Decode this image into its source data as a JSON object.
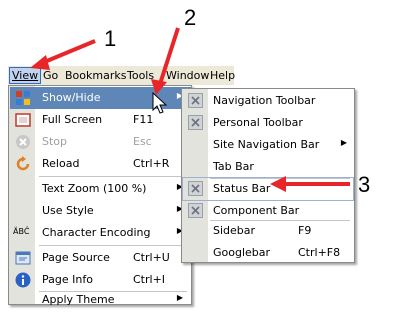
{
  "callouts": {
    "one": "1",
    "two": "2",
    "three": "3"
  },
  "menubar": {
    "items": [
      {
        "label": "View",
        "key": "V"
      },
      {
        "label": "Go",
        "key": "G"
      },
      {
        "label": "Bookmarks",
        "key": "B"
      },
      {
        "label": "Tools",
        "key": "T"
      },
      {
        "label": "Window",
        "key": "W"
      },
      {
        "label": "Help",
        "key": "H"
      }
    ]
  },
  "view_menu": {
    "items": [
      {
        "label": "Show/Hide",
        "shortcut": "",
        "submenu": true,
        "icon": "show-hide-icon",
        "state": "highlighted"
      },
      {
        "label": "Full Screen",
        "shortcut": "F11",
        "icon": "full-screen-icon"
      },
      {
        "label": "Stop",
        "shortcut": "Esc",
        "icon": "stop-icon",
        "state": "disabled"
      },
      {
        "label": "Reload",
        "shortcut": "Ctrl+R",
        "icon": "reload-icon"
      },
      {
        "label": "Text Zoom (100 %)",
        "shortcut": "",
        "submenu": true
      },
      {
        "label": "Use Style",
        "shortcut": "",
        "submenu": true
      },
      {
        "label": "Character Encoding",
        "shortcut": "",
        "submenu": true,
        "icon": "character-encoding-icon",
        "icon_text": "ÄBĈ"
      },
      {
        "label": "Page Source",
        "shortcut": "Ctrl+U",
        "icon": "page-source-icon"
      },
      {
        "label": "Page Info",
        "shortcut": "Ctrl+I",
        "icon": "page-info-icon"
      },
      {
        "label": "Apply Theme",
        "shortcut": "",
        "submenu": true
      }
    ]
  },
  "show_hide_menu": {
    "items": [
      {
        "label": "Navigation Toolbar",
        "checked": true
      },
      {
        "label": "Personal Toolbar",
        "checked": true
      },
      {
        "label": "Site Navigation Bar",
        "submenu": true
      },
      {
        "label": "Tab Bar"
      },
      {
        "label": "Status Bar",
        "checked": true,
        "state": "highlighted"
      },
      {
        "label": "Component Bar",
        "checked": true
      },
      {
        "label": "Sidebar",
        "shortcut": "F9"
      },
      {
        "label": "Googlebar",
        "shortcut": "Ctrl+F8"
      }
    ]
  },
  "colors": {
    "arrow": "#e8262a",
    "highlight": "#5e86b6",
    "menubar_bg": "#ece9d8"
  }
}
